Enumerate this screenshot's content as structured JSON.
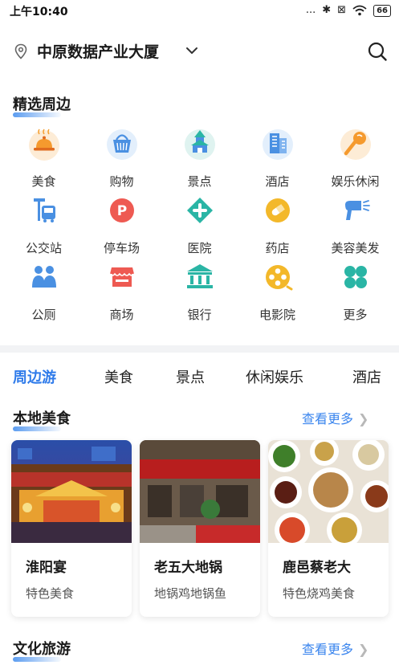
{
  "status_bar": {
    "time": "上午10:40",
    "signal": "...",
    "bluetooth": "✱",
    "sim": "⊠",
    "wifi": "wifi-icon",
    "battery": "66"
  },
  "location": {
    "name": "中原数据产业大厦"
  },
  "featured": {
    "title": "精选周边",
    "items": [
      {
        "label": "美食",
        "icon": "food-icon"
      },
      {
        "label": "购物",
        "icon": "shopping-icon"
      },
      {
        "label": "景点",
        "icon": "attraction-icon"
      },
      {
        "label": "酒店",
        "icon": "hotel-icon"
      },
      {
        "label": "娱乐休闲",
        "icon": "entertainment-icon"
      },
      {
        "label": "公交站",
        "icon": "bus-stop-icon"
      },
      {
        "label": "停车场",
        "icon": "parking-icon"
      },
      {
        "label": "医院",
        "icon": "hospital-icon"
      },
      {
        "label": "药店",
        "icon": "pharmacy-icon"
      },
      {
        "label": "美容美发",
        "icon": "beauty-icon"
      },
      {
        "label": "公厕",
        "icon": "toilet-icon"
      },
      {
        "label": "商场",
        "icon": "mall-icon"
      },
      {
        "label": "银行",
        "icon": "bank-icon"
      },
      {
        "label": "电影院",
        "icon": "cinema-icon"
      },
      {
        "label": "更多",
        "icon": "more-icon"
      }
    ]
  },
  "tabs": [
    "周边游",
    "美食",
    "景点",
    "休闲娱乐",
    "酒店"
  ],
  "local_food": {
    "title": "本地美食",
    "more": "查看更多",
    "cards": [
      {
        "name": "淮阳宴",
        "desc": "特色美食"
      },
      {
        "name": "老五大地锅",
        "desc": "地锅鸡地锅鱼"
      },
      {
        "name": "鹿邑蔡老大",
        "desc": "特色烧鸡美食"
      }
    ]
  },
  "culture": {
    "title": "文化旅游",
    "more": "查看更多"
  },
  "colors": {
    "accent": "#2f7bea",
    "link": "#3a85ee",
    "orange": "#f5a033",
    "blue": "#4a90e2",
    "red": "#ee5a52",
    "teal": "#2ab5a5",
    "yellow": "#f3b82a"
  }
}
